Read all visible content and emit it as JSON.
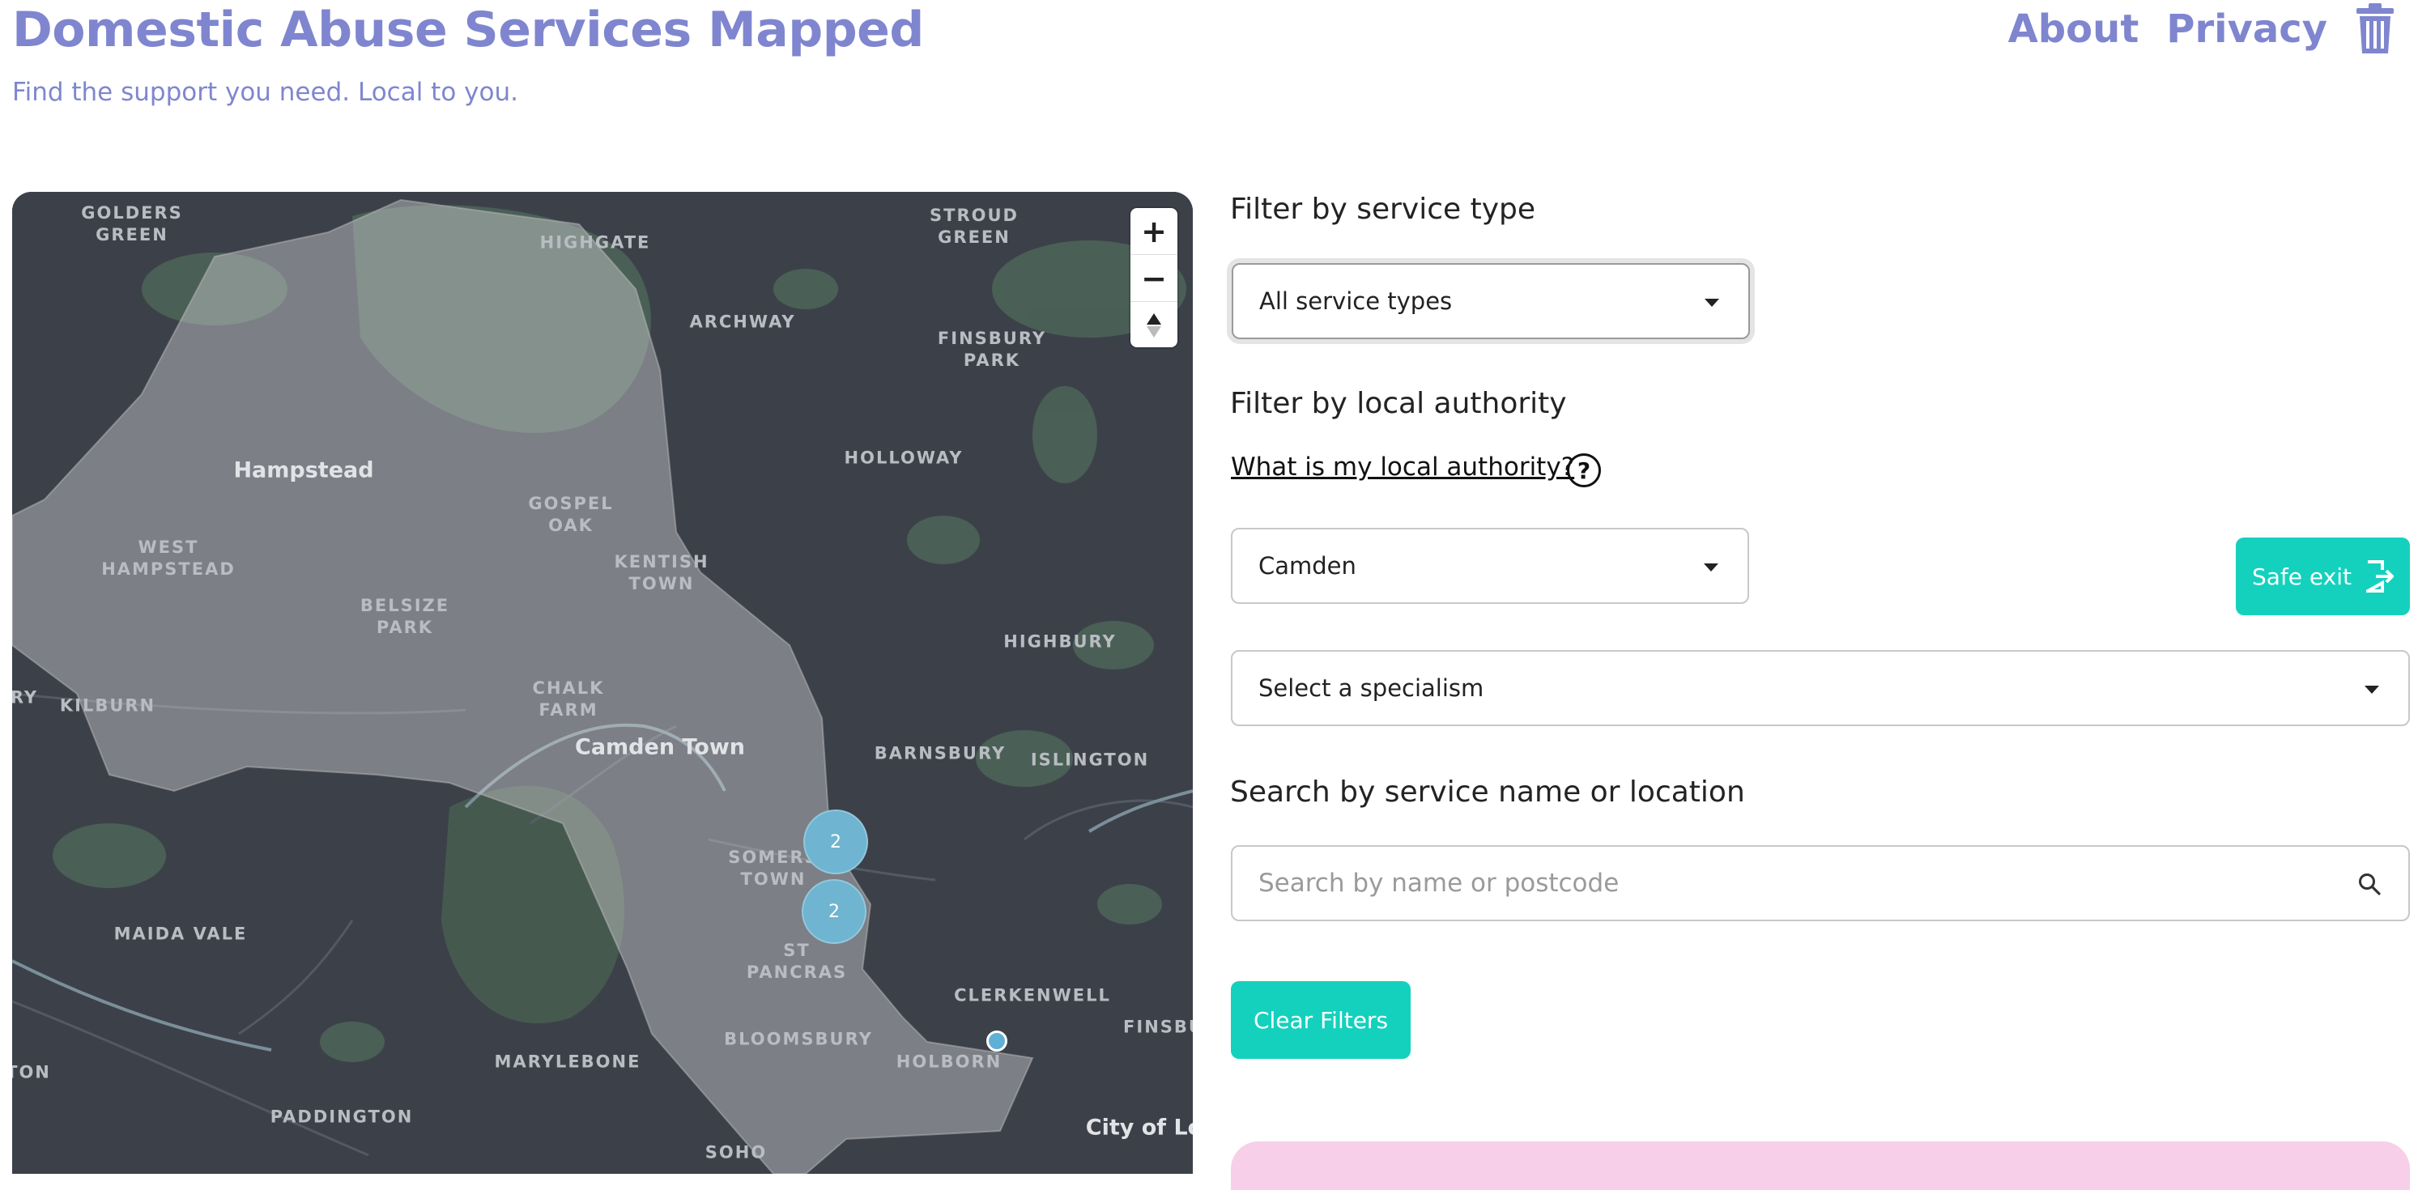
{
  "header": {
    "title": "Domestic Abuse Services Mapped",
    "tagline": "Find the support you need. Local to you.",
    "nav": {
      "about": "About",
      "privacy": "Privacy"
    }
  },
  "map": {
    "places": {
      "golders_green": "GOLDERS\nGREEN",
      "highgate": "HIGHGATE",
      "stroud_green": "STROUD\nGREEN",
      "archway": "ARCHWAY",
      "finsbury_park": "FINSBURY\nPARK",
      "holloway": "HOLLOWAY",
      "hampstead": "Hampstead",
      "gospel_oak": "GOSPEL\nOAK",
      "kentish_town": "KENTISH\nTOWN",
      "west_hampstead": "WEST\nHAMPSTEAD",
      "belsize_park": "BELSIZE\nPARK",
      "highbury": "HIGHBURY",
      "chalk_farm": "CHALK\nFARM",
      "kilburn": "KILBURN",
      "ry": "RY",
      "camden_town": "Camden Town",
      "barnsbury": "BARNSBURY",
      "islington": "ISLINGTON",
      "somers_town": "SOMERS\nTOWN",
      "st_pancras": "ST\nPANCRAS",
      "maida_vale": "MAIDA VALE",
      "clerkenwell": "CLERKENWELL",
      "finsbu": "FINSBU",
      "bloomsbury": "BLOOMSBURY",
      "holborn": "HOLBORN",
      "marylebone": "MARYLEBONE",
      "ton": "TON",
      "paddington": "PADDINGTON",
      "city_of_lo": "City of Lo",
      "soho": "SOHO"
    },
    "clusters": [
      "2",
      "2"
    ],
    "zoom_in": "+",
    "zoom_out": "−",
    "compass": "▲"
  },
  "filters": {
    "service_type_heading": "Filter by service type",
    "service_type_value": "All service types",
    "local_authority_heading": "Filter by local authority",
    "local_authority_link": "What is my local authority?",
    "help_glyph": "?",
    "local_authority_value": "Camden",
    "specialism_value": "Select a specialism",
    "search_heading": "Search by service name or location",
    "search_placeholder": "Search by name or postcode",
    "clear_label": "Clear Filters"
  },
  "safe_exit": {
    "label": "Safe exit"
  },
  "colors": {
    "brand": "#7f86cf",
    "accent": "#14d1bd",
    "card_pink": "#f7cfe8",
    "map_bg": "#3c4149"
  }
}
